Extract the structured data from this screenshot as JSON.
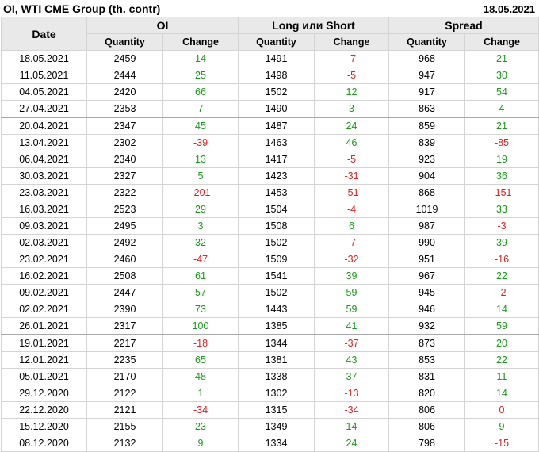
{
  "header": {
    "title": "OI, WTI CME Group (th. contr)",
    "date": "18.05.2021"
  },
  "columns": {
    "date": "Date",
    "groups": [
      "OI",
      "Long или Short",
      "Spread"
    ],
    "sub": [
      "Quantity",
      "Change",
      "Quantity",
      "Change",
      "Quantity",
      "Change"
    ]
  },
  "colors": {
    "positive": "#1a9a1a",
    "negative": "#e02020"
  },
  "separators_after": [
    3,
    16
  ],
  "rows": [
    [
      "18.05.2021",
      "2459",
      "14",
      "1491",
      "-7",
      "968",
      "21"
    ],
    [
      "11.05.2021",
      "2444",
      "25",
      "1498",
      "-5",
      "947",
      "30"
    ],
    [
      "04.05.2021",
      "2420",
      "66",
      "1502",
      "12",
      "917",
      "54"
    ],
    [
      "27.04.2021",
      "2353",
      "7",
      "1490",
      "3",
      "863",
      "4"
    ],
    [
      "20.04.2021",
      "2347",
      "45",
      "1487",
      "24",
      "859",
      "21"
    ],
    [
      "13.04.2021",
      "2302",
      "-39",
      "1463",
      "46",
      "839",
      "-85"
    ],
    [
      "06.04.2021",
      "2340",
      "13",
      "1417",
      "-5",
      "923",
      "19"
    ],
    [
      "30.03.2021",
      "2327",
      "5",
      "1423",
      "-31",
      "904",
      "36"
    ],
    [
      "23.03.2021",
      "2322",
      "-201",
      "1453",
      "-51",
      "868",
      "-151"
    ],
    [
      "16.03.2021",
      "2523",
      "29",
      "1504",
      "-4",
      "1019",
      "33"
    ],
    [
      "09.03.2021",
      "2495",
      "3",
      "1508",
      "6",
      "987",
      "-3"
    ],
    [
      "02.03.2021",
      "2492",
      "32",
      "1502",
      "-7",
      "990",
      "39"
    ],
    [
      "23.02.2021",
      "2460",
      "-47",
      "1509",
      "-32",
      "951",
      "-16"
    ],
    [
      "16.02.2021",
      "2508",
      "61",
      "1541",
      "39",
      "967",
      "22"
    ],
    [
      "09.02.2021",
      "2447",
      "57",
      "1502",
      "59",
      "945",
      "-2"
    ],
    [
      "02.02.2021",
      "2390",
      "73",
      "1443",
      "59",
      "946",
      "14"
    ],
    [
      "26.01.2021",
      "2317",
      "100",
      "1385",
      "41",
      "932",
      "59"
    ],
    [
      "19.01.2021",
      "2217",
      "-18",
      "1344",
      "-37",
      "873",
      "20"
    ],
    [
      "12.01.2021",
      "2235",
      "65",
      "1381",
      "43",
      "853",
      "22"
    ],
    [
      "05.01.2021",
      "2170",
      "48",
      "1338",
      "37",
      "831",
      "11"
    ],
    [
      "29.12.2020",
      "2122",
      "1",
      "1302",
      "-13",
      "820",
      "14"
    ],
    [
      "22.12.2020",
      "2121",
      "-34",
      "1315",
      "-34",
      "806",
      "0"
    ],
    [
      "15.12.2020",
      "2155",
      "23",
      "1349",
      "14",
      "806",
      "9"
    ],
    [
      "08.12.2020",
      "2132",
      "9",
      "1334",
      "24",
      "798",
      "-15"
    ]
  ]
}
